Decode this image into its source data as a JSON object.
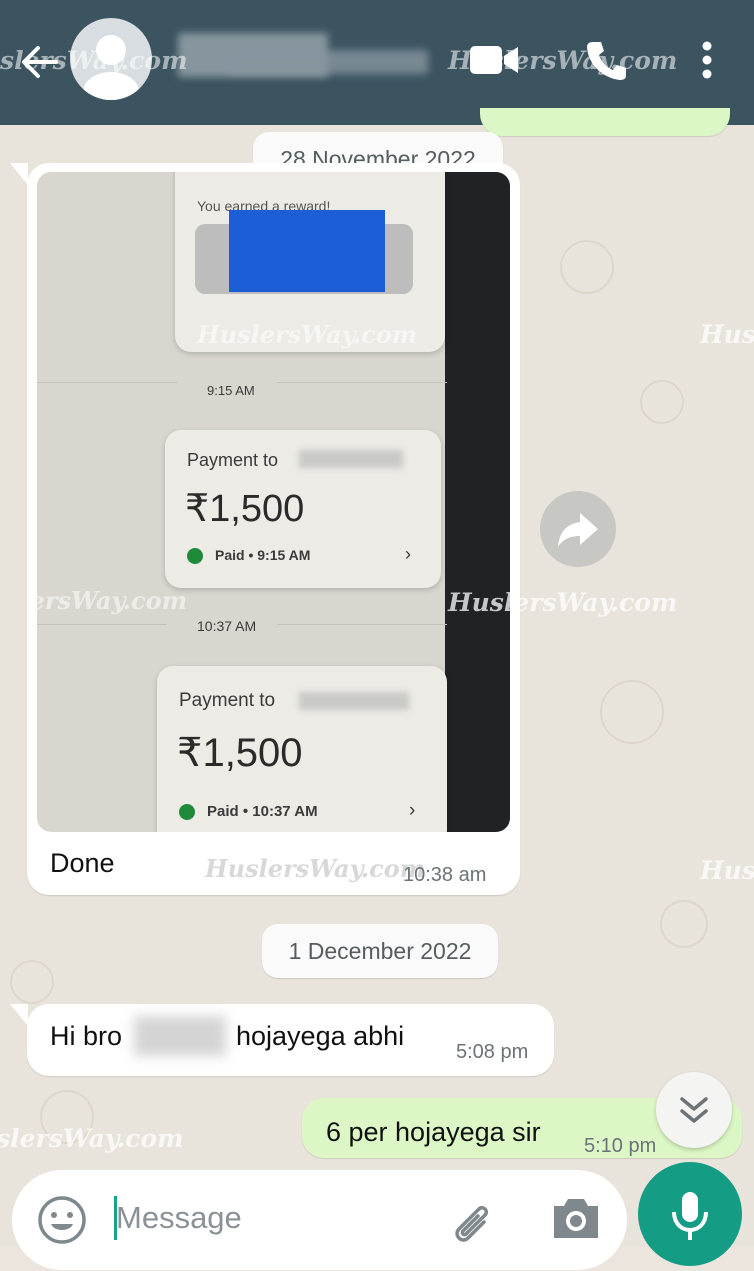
{
  "header": {
    "back_icon": "arrow-left-icon",
    "avatar_icon": "person-icon",
    "icons": [
      "video-call-icon",
      "phone-icon",
      "more-vert-icon"
    ],
    "watermark_left": "slersWay.com",
    "watermark_right": "HuslersWay.com"
  },
  "chat": {
    "date1": "28 November 2022",
    "photo": {
      "reward_text": "You earned a reward!",
      "time1": "9:15 AM",
      "payment1_label": "Payment to",
      "payment1_amount": "₹1,500",
      "payment1_status": "Paid • 9:15 AM",
      "time2": "10:37 AM",
      "payment2_label": "Payment to",
      "payment2_amount": "₹1,500",
      "payment2_status": "Paid • 10:37 AM",
      "watermark": "HuslersWay.com"
    },
    "msg1_text": "Done",
    "msg1_time": "10:38 am",
    "date2": "1 December 2022",
    "msg2_text_a": "Hi bro",
    "msg2_text_b": "hojayega abhi",
    "msg2_time": "5:08 pm",
    "msg3_text": "6 per hojayega sir",
    "msg3_time": "5:10 pm",
    "watermarks": [
      "slersWay.com",
      "HuslersWay.com",
      "Husl",
      "HuslersWay.com",
      "Husl",
      "slersWay.com"
    ]
  },
  "composer": {
    "placeholder": "Message",
    "emoji_icon": "emoji-icon",
    "attach_icon": "paperclip-icon",
    "camera_icon": "camera-icon",
    "mic_icon": "microphone-icon",
    "scroll_icon": "double-chevron-down-icon"
  },
  "colors": {
    "header": "#3b5460",
    "incoming": "#ffffff",
    "outgoing": "#dcf7c5",
    "accent": "#149c85"
  }
}
